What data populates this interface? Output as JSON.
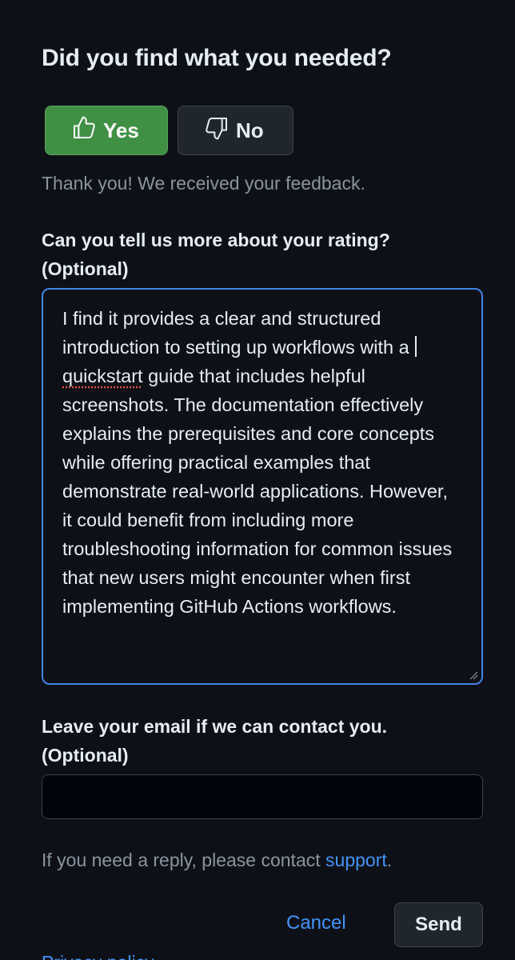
{
  "feedback": {
    "title": "Did you find what you needed?",
    "yes_label": "Yes",
    "no_label": "No",
    "thanks_text": "Thank you! We received your feedback.",
    "rating_label": "Can you tell us more about your rating? (Optional)",
    "comment_before": "I find it provides a clear and structured introduction to setting up workflows with a ",
    "comment_misspelled": "quickstart",
    "comment_after": " guide that includes helpful screenshots. The documentation effectively explains the prerequisites and core concepts while offering practical examples that demonstrate real-world applications. However, it could benefit from including more troubleshooting information for common issues that new users might encounter when first implementing GitHub Actions workflows.",
    "email_label": "Leave your email if we can contact you. (Optional)",
    "email_value": "",
    "reply_prefix": "If you need a reply, please contact ",
    "reply_link": "support",
    "reply_suffix": ".",
    "cancel_label": "Cancel",
    "send_label": "Send",
    "privacy_label": "Privacy policy"
  },
  "colors": {
    "background": "#0d1117",
    "yes_button": "#3f8f45",
    "focus_border": "#4184e4",
    "link": "#4493f8",
    "muted_text": "#8b949e"
  },
  "icons": {
    "yes": "thumbs-up-icon",
    "no": "thumbs-down-icon"
  }
}
